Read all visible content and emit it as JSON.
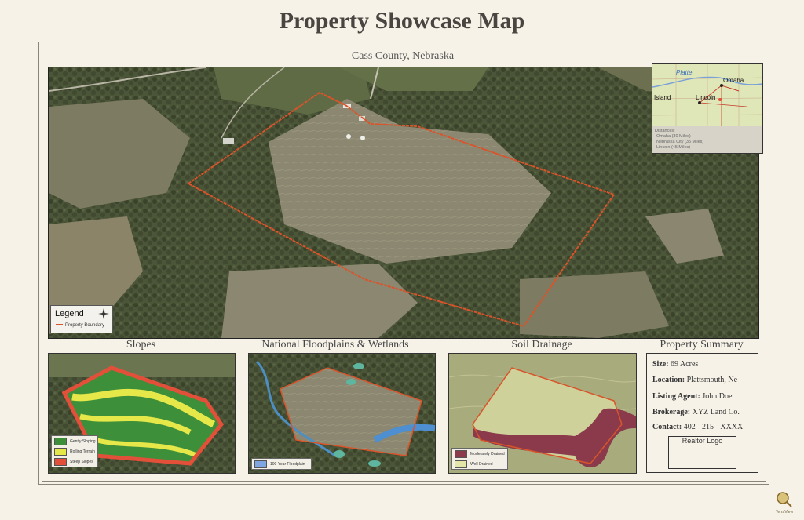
{
  "title": "Property Showcase Map",
  "main_map": {
    "subtitle": "Cass County, Nebraska",
    "legend": {
      "title": "Legend",
      "item": "Property Boundary",
      "color": "#d9542a"
    }
  },
  "inset": {
    "labels": {
      "river": "Platte",
      "omaha": "Omaha",
      "lincoln": "Lincoln",
      "island": "Island"
    },
    "distance_title": "Distances:",
    "distances": [
      "Omaha (30 Miles)",
      "Nebraska City (35 Miles)",
      "Lincoln (45 Miles)"
    ]
  },
  "slopes": {
    "title": "Slopes",
    "legend": [
      {
        "label": "Gently Sloping",
        "color": "#3d8f3a"
      },
      {
        "label": "Rolling Terrain",
        "color": "#e6e84a"
      },
      {
        "label": "Steep Slopes",
        "color": "#e2503a"
      }
    ]
  },
  "floodplains": {
    "title": "National Floodplains & Wetlands",
    "legend": [
      {
        "label": "100-Year Floodplain",
        "color": "#7fa6e0"
      }
    ]
  },
  "soil": {
    "title": "Soil Drainage",
    "legend": [
      {
        "label": "Moderately Drained",
        "color": "#8a3a4a"
      },
      {
        "label": "Well Drained",
        "color": "#e4e5a8"
      }
    ]
  },
  "summary": {
    "title": "Property Summary",
    "size_label": "Size:",
    "size_value": "69 Acres",
    "location_label": "Location:",
    "location_value": "Plattsmouth, Ne",
    "agent_label": "Listing Agent:",
    "agent_value": "John Doe",
    "brokerage_label": "Brokerage:",
    "brokerage_value": "XYZ Land Co.",
    "contact_label": "Contact:",
    "contact_value": "402 - 215 - XXXX",
    "logo_placeholder": "Realtor Logo"
  },
  "brand": "TerraView"
}
